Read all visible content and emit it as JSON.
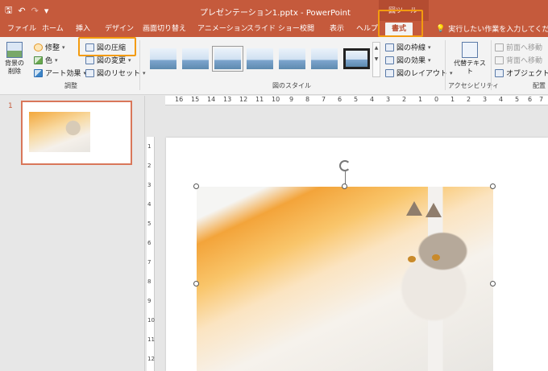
{
  "app": {
    "title": "プレゼンテーション1.pptx - PowerPoint",
    "contextual_group": "図ツール"
  },
  "qat": {
    "undo": "↶",
    "redo": "↷",
    "save": "🖫",
    "more": "▾"
  },
  "tabs": [
    "ファイル",
    "ホーム",
    "挿入",
    "デザイン",
    "画面切り替え",
    "アニメーション",
    "スライド ショー",
    "校閲",
    "表示",
    "ヘルプ",
    "書式"
  ],
  "active_tab": "書式",
  "tell_me": "実行したい作業を入力してください",
  "ribbon": {
    "adjust": {
      "remove_bg": "背景の削除",
      "corrections": "修整",
      "color": "色",
      "artistic": "アート効果",
      "compress": "図の圧縮",
      "change": "図の変更",
      "reset": "図のリセット",
      "label": "調整"
    },
    "styles": {
      "label": "図のスタイル",
      "border": "図の枠線",
      "effects": "図の効果",
      "layout": "図のレイアウト"
    },
    "accessibility": {
      "alt_text": "代替テキスト",
      "label": "アクセシビリティ"
    },
    "arrange": {
      "forward": "前面へ移動",
      "backward": "背面へ移動",
      "selection_pane": "オブジェクトの選択",
      "label": "配置"
    }
  },
  "slides": {
    "number": "1"
  },
  "ruler": [
    "16",
    "15",
    "14",
    "13",
    "12",
    "11",
    "10",
    "9",
    "8",
    "7",
    "6",
    "5",
    "4",
    "3",
    "2",
    "1",
    "0",
    "1",
    "2",
    "3",
    "4",
    "5",
    "6",
    "7"
  ],
  "vruler": [
    "1",
    "2",
    "3",
    "4",
    "5",
    "6",
    "7",
    "8",
    "9",
    "10",
    "11",
    "12"
  ],
  "colors": {
    "accent": "#c55a3c",
    "highlight": "#f39b0f"
  }
}
